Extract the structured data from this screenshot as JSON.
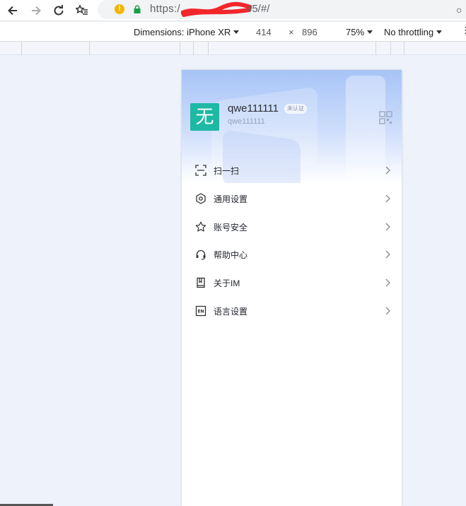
{
  "browser": {
    "url_prefix": "https:/",
    "url_suffix": "45/#/",
    "warning_glyph": "!"
  },
  "devtools": {
    "dimensions_label": "Dimensions: iPhone XR",
    "width": "414",
    "times": "×",
    "height": "896",
    "zoom": "75%",
    "throttling": "No throttling"
  },
  "profile": {
    "avatar_char": "无",
    "username": "qwe111111",
    "badge": "未认证",
    "account": "qwe111111"
  },
  "menu": {
    "items": [
      {
        "label": "扫一扫",
        "icon": "scan-icon"
      },
      {
        "label": "通用设置",
        "icon": "settings-hex-icon"
      },
      {
        "label": "账号安全",
        "icon": "star-icon"
      },
      {
        "label": "帮助中心",
        "icon": "headset-icon"
      },
      {
        "label": "关于IM",
        "icon": "book-icon"
      },
      {
        "label": "语言设置",
        "icon": "language-en-icon"
      }
    ]
  },
  "colors": {
    "avatar_bg": "#1eb8a4",
    "hero_top": "#a7c4f7",
    "page_bg": "#eef2fb"
  }
}
